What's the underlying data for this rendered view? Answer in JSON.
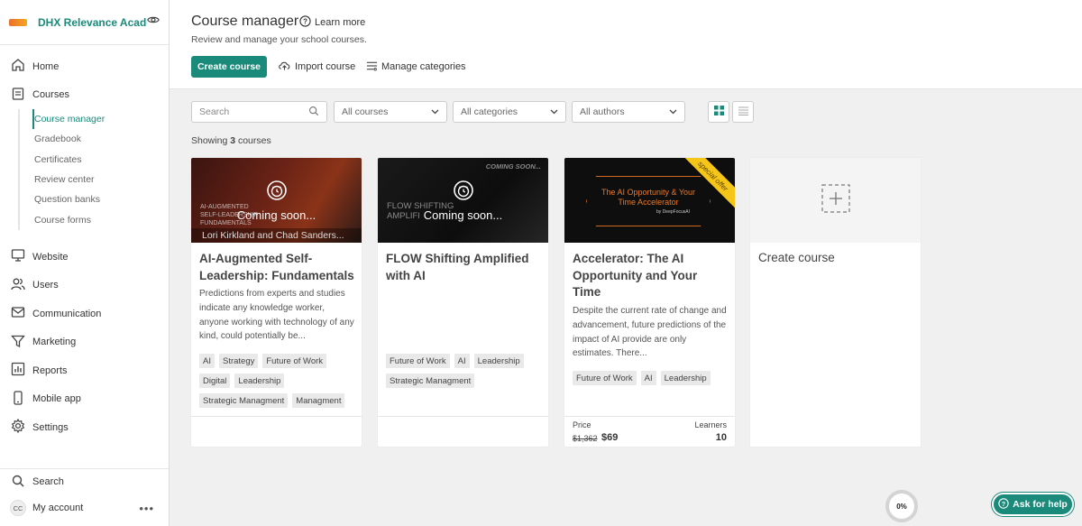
{
  "brand": {
    "name": "DHX Relevance Acade..."
  },
  "nav": {
    "home": "Home",
    "courses": "Courses",
    "sub": [
      "Course manager",
      "Gradebook",
      "Certificates",
      "Review center",
      "Question banks",
      "Course forms"
    ],
    "website": "Website",
    "users": "Users",
    "communication": "Communication",
    "marketing": "Marketing",
    "reports": "Reports",
    "mobile_app": "Mobile app",
    "settings": "Settings",
    "search": "Search",
    "my_account": "My account",
    "avatar_initials": "CC"
  },
  "header": {
    "title": "Course manager",
    "learn_more": "Learn more",
    "subtitle": "Review and manage your school courses.",
    "create_course": "Create course",
    "import_course": "Import course",
    "manage_categories": "Manage categories"
  },
  "filters": {
    "search_placeholder": "Search",
    "courses": "All courses",
    "categories": "All categories",
    "authors": "All authors"
  },
  "showing": {
    "prefix": "Showing",
    "count": "3",
    "suffix": "courses"
  },
  "cards": [
    {
      "thumb_overlay": "Coming soon...",
      "thumb_caption": "Lori Kirkland and Chad Sanders...",
      "thumb_text": "AI-AUGMENTED SELF-LEADERSHIP FUNDAMENTALS",
      "title": "AI-Augmented Self-Leadership: Fundamentals",
      "description": "Predictions from experts and studies indicate any knowledge worker, anyone working with technology of any kind, could potentially be...",
      "tags": [
        "AI",
        "Strategy",
        "Future of Work",
        "Digital",
        "Leadership",
        "Strategic Managment",
        "Managment"
      ]
    },
    {
      "thumb_overlay": "Coming soon...",
      "thumb_badge": "COMING SOON...",
      "thumb_text": "FLOW SHIFTING AMPLIFI",
      "title": "FLOW Shifting Amplified with AI",
      "description": "",
      "tags": [
        "Future of Work",
        "AI",
        "Leadership",
        "Strategic Managment"
      ]
    },
    {
      "ribbon": "special offer",
      "thumb_title": "The AI Opportunity & Your Time Accelerator",
      "thumb_sub": "by DeepFocusAI",
      "title": "Accelerator: The AI Opportunity and Your Time",
      "description": "Despite the current rate of change and advancement, future predictions of the impact of AI provide are only estimates. There...",
      "tags": [
        "Future of Work",
        "AI",
        "Leadership"
      ],
      "price_label": "Price",
      "price_old": "$1,362",
      "price_new": "$69",
      "learners_label": "Learners",
      "learners": "10"
    }
  ],
  "create_card": {
    "title": "Create course"
  },
  "widgets": {
    "progress": "0%",
    "help": "Ask for help"
  },
  "colors": {
    "accent": "#1a8a7a",
    "ribbon": "#f5c518"
  }
}
